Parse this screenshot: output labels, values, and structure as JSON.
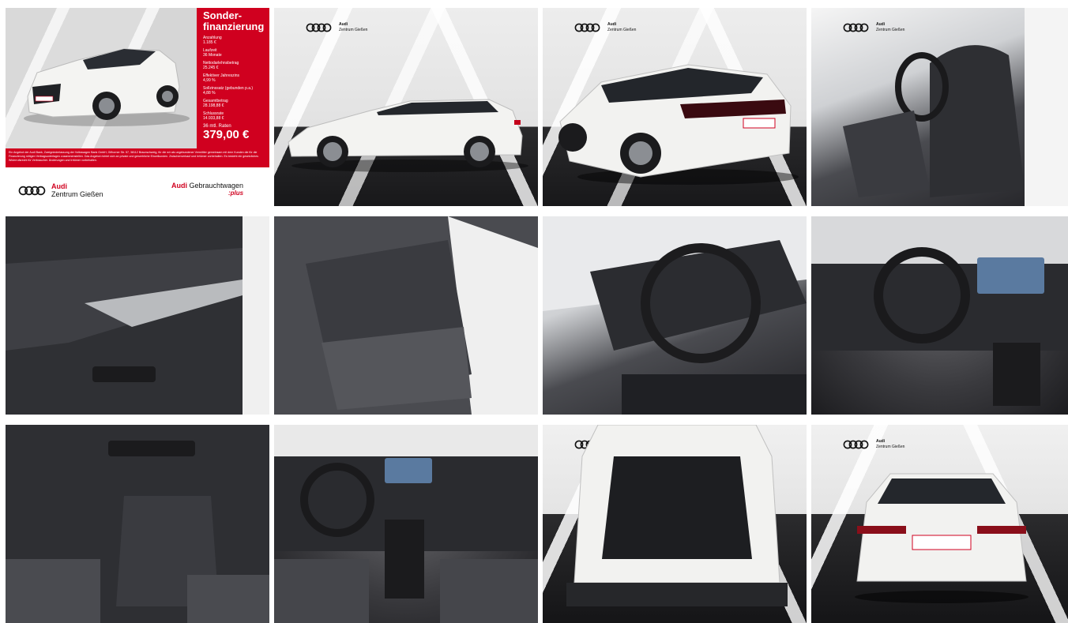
{
  "dealer": {
    "brand": "Audi",
    "name": "Zentrum Gießen"
  },
  "promo": {
    "title": "Sonder-finanzierung",
    "items": [
      {
        "label": "Anzahlung",
        "value": "1.185 €"
      },
      {
        "label": "Laufzeit",
        "value": "36 Monate"
      },
      {
        "label": "Nettodarlehnsbetrag",
        "value": "25.245 €"
      },
      {
        "label": "Effektiver Jahreszins",
        "value": "4,99 %"
      },
      {
        "label": "Sollzinssatz (gebunden p.a.)",
        "value": "4,88 %"
      },
      {
        "label": "Gesamtbetrag",
        "value": "28.198,88 €"
      },
      {
        "label": "Schlussrate",
        "value": "14.933,88 €"
      }
    ],
    "rate_label": "36 mtl. Raten",
    "rate_value": "379,00 €",
    "disclaimer": "Ein Angebot der Audi Bank, Zweigniederlassung der Volkswagen Bank GmbH, Gifhorner Str. 57, 38112 Braunschweig, für die wir als ungebundener Vermittler gemeinsam mit dem Kunden die für die Finanzierung nötigen Vertragsunterlagen zusammenstellen. Das Angebot richtet sich an private und gewerbliche Einzelkunden. Zwischenverkauf und Irrtümer vorbehalten. Es besteht ein gesetzliches Widerrufsrecht für Verbraucher. Änderungen und Irrtümer vorbehalten.",
    "footer_brand": "Audi",
    "footer_dealer": "Zentrum Gießen",
    "footer_right_brand": "Audi",
    "footer_right_text": "Gebrauchtwagen",
    "footer_right_plus": ":plus"
  },
  "colors": {
    "audi_red": "#d0001f",
    "car_white": "#f2f2f0"
  }
}
